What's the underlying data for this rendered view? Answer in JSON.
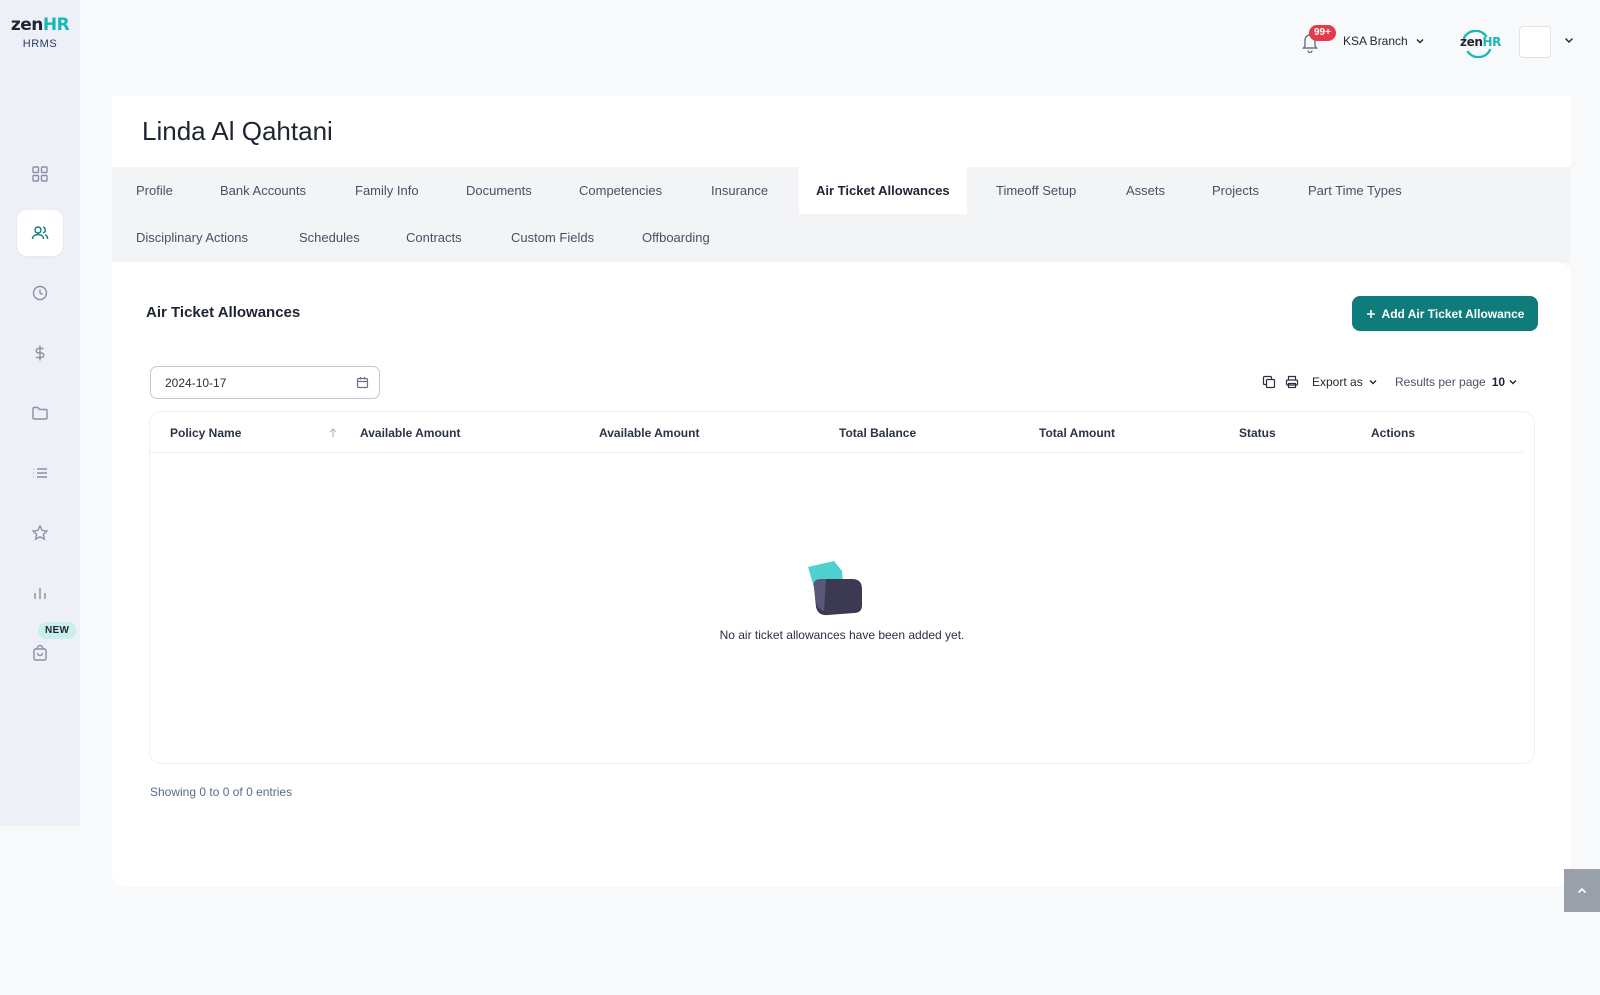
{
  "brand": {
    "word_main": "zen",
    "word_accent": "HR",
    "subtitle": "HRMS",
    "accent_color": "#18b7b7"
  },
  "sidebar": {
    "items": [
      {
        "icon": "dashboard-icon",
        "active": false
      },
      {
        "icon": "users-icon",
        "active": true
      },
      {
        "icon": "clock-icon",
        "active": false
      },
      {
        "icon": "dollar-icon",
        "active": false
      },
      {
        "icon": "folder-icon",
        "active": false
      },
      {
        "icon": "list-icon",
        "active": false
      },
      {
        "icon": "star-icon",
        "active": false
      },
      {
        "icon": "bar-chart-icon",
        "active": false
      },
      {
        "icon": "shopping-bag-icon",
        "active": false
      }
    ],
    "new_badge": "NEW"
  },
  "topbar": {
    "notification_count": "99+",
    "branch": "KSA Branch",
    "brand_small_main": "zen",
    "brand_small_accent": "HR"
  },
  "page": {
    "title": "Linda Al Qahtani"
  },
  "tabs": [
    {
      "label": "Profile",
      "active": false
    },
    {
      "label": "Bank Accounts",
      "active": false
    },
    {
      "label": "Family Info",
      "active": false
    },
    {
      "label": "Documents",
      "active": false
    },
    {
      "label": "Competencies",
      "active": false
    },
    {
      "label": "Insurance",
      "active": false
    },
    {
      "label": "Air Ticket Allowances",
      "active": true
    },
    {
      "label": "Timeoff Setup",
      "active": false
    },
    {
      "label": "Assets",
      "active": false
    },
    {
      "label": "Projects",
      "active": false
    },
    {
      "label": "Part Time Types",
      "active": false
    },
    {
      "label": "Disciplinary Actions",
      "active": false
    },
    {
      "label": "Schedules",
      "active": false
    },
    {
      "label": "Contracts",
      "active": false
    },
    {
      "label": "Custom Fields",
      "active": false
    },
    {
      "label": "Offboarding",
      "active": false
    }
  ],
  "section": {
    "title": "Air Ticket Allowances",
    "add_button": "Add Air Ticket Allowance",
    "date_value": "2024-10-17",
    "export_label": "Export as",
    "results_per_page_label": "Results per page",
    "results_per_page_value": "10"
  },
  "table": {
    "columns": [
      "Policy Name",
      "Available Amount",
      "Available Amount",
      "Total Balance",
      "Total Amount",
      "Status",
      "Actions"
    ],
    "rows": [],
    "empty_message": "No air ticket allowances have been added yet."
  },
  "footer": {
    "showing": "Showing 0 to 0 of 0 entries"
  },
  "colors": {
    "primary_button": "#0f7b7b",
    "notification_badge": "#e23b4b",
    "sidebar_bg": "#edf0f6"
  }
}
